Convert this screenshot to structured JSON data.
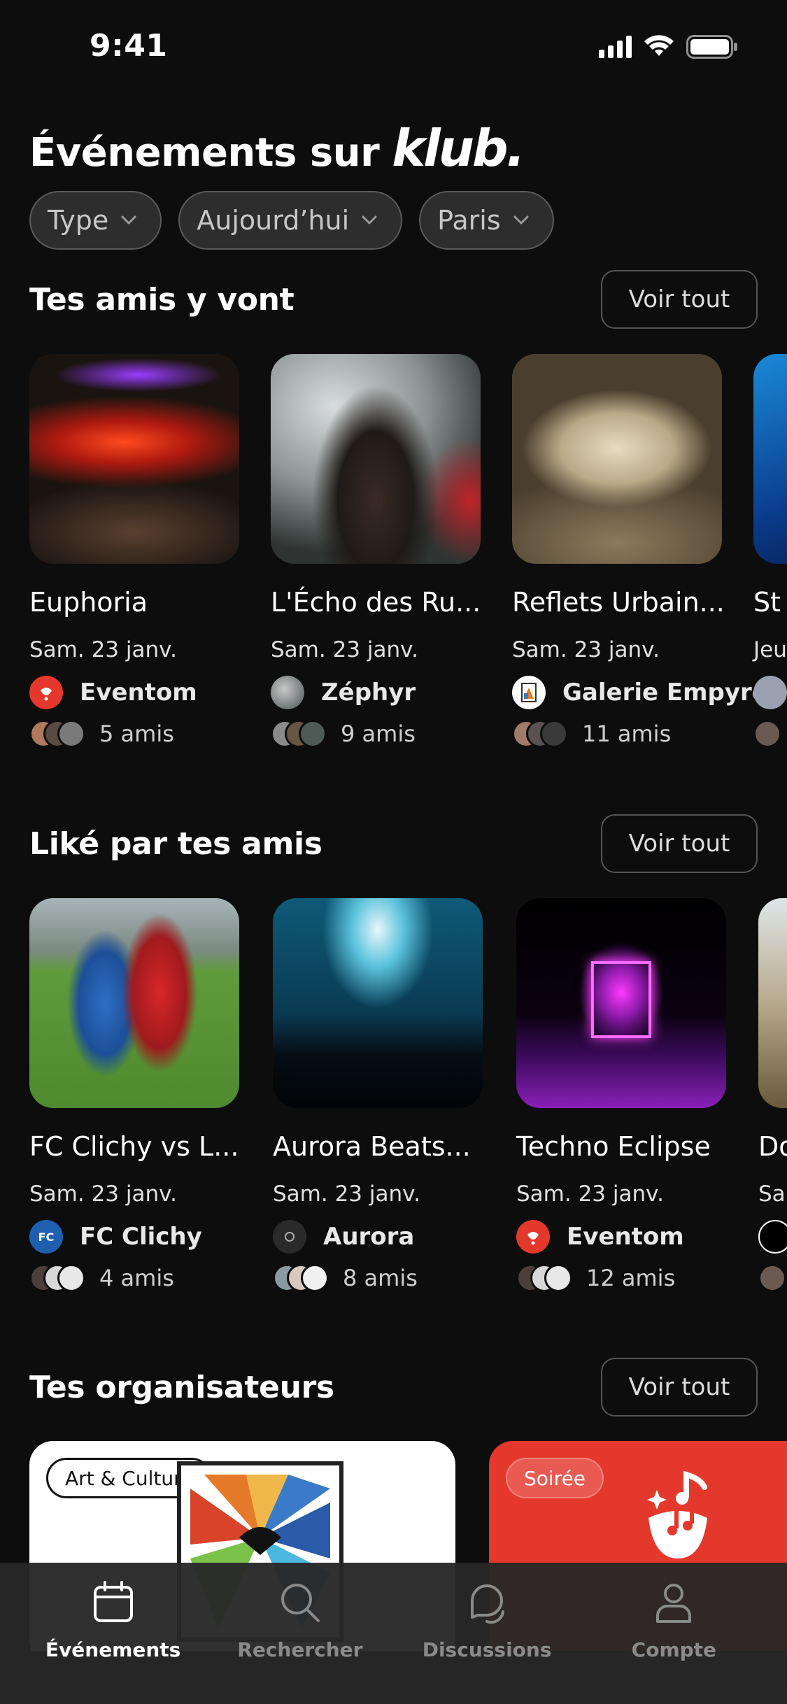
{
  "status": {
    "time": "9:41"
  },
  "header": {
    "title": "Événements sur",
    "brand": "klub."
  },
  "filters": [
    {
      "label": "Type"
    },
    {
      "label": "Aujourd’hui"
    },
    {
      "label": "Paris"
    }
  ],
  "sections": [
    {
      "title": "Tes amis y vont",
      "see_all": "Voir tout",
      "cards": [
        {
          "title": "Euphoria",
          "date": "Sam. 23 janv.",
          "organizer": "Eventom",
          "friends": "5 amis"
        },
        {
          "title": "L'Écho des Ru...",
          "date": "Sam. 23 janv.",
          "organizer": "Zéphyr",
          "friends": "9 amis"
        },
        {
          "title": "Reflets Urbain...",
          "date": "Sam. 23 janv.",
          "organizer": "Galerie Empyre",
          "friends": "11 amis"
        },
        {
          "title": "St",
          "date": "Jeu",
          "organizer": "",
          "friends": ""
        }
      ]
    },
    {
      "title": "Liké par tes amis",
      "see_all": "Voir tout",
      "cards": [
        {
          "title": "FC Clichy vs L...",
          "date": "Sam. 23 janv.",
          "organizer": "FC Clichy",
          "friends": "4 amis"
        },
        {
          "title": "Aurora Beats...",
          "date": "Sam. 23 janv.",
          "organizer": "Aurora",
          "friends": "8 amis"
        },
        {
          "title": "Techno Eclipse",
          "date": "Sam. 23 janv.",
          "organizer": "Eventom",
          "friends": "12 amis"
        },
        {
          "title": "Do",
          "date": "Sa",
          "organizer": "",
          "friends": ""
        }
      ]
    },
    {
      "title": "Tes organisateurs",
      "see_all": "Voir tout",
      "organizers": [
        {
          "tag": "Art & Culture"
        },
        {
          "tag": "Soirée"
        }
      ]
    }
  ],
  "tabbar": [
    {
      "label": "Événements",
      "icon": "calendar-icon",
      "active": true
    },
    {
      "label": "Rechercher",
      "icon": "search-icon",
      "active": false
    },
    {
      "label": "Discussions",
      "icon": "chat-icon",
      "active": false
    },
    {
      "label": "Compte",
      "icon": "user-icon",
      "active": false
    }
  ],
  "colors": {
    "background": "#0d0d0d",
    "accent_red": "#e5382d",
    "chip_bg": "#2d2d2d"
  }
}
